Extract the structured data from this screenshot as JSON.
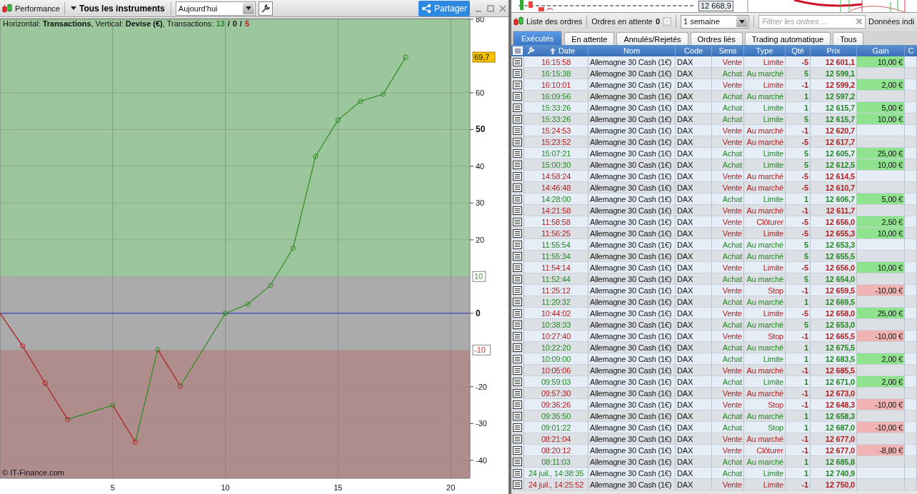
{
  "performance": {
    "title": "Performance",
    "instrument_menu": "Tous les instruments",
    "period": "Aujourd'hui",
    "share_button": "Partager",
    "info": {
      "text": "Horizontal: **Transactions**, Vertical: **Devise (€)**, Transactions:",
      "separator": "/",
      "counts": [
        {
          "value": "13",
          "kind": "win"
        },
        {
          "value": "0",
          "kind": "neutral"
        },
        {
          "value": "5",
          "kind": "loss"
        }
      ]
    },
    "chart": {
      "chart_data": {
        "type": "line",
        "x": [
          0,
          1,
          2,
          3,
          5,
          6,
          7,
          8,
          10,
          11,
          12,
          13,
          14,
          15,
          16,
          17,
          18
        ],
        "series": [
          {
            "color": "#b01c1c",
            "marker": "o",
            "values": [
              0,
              -8.9,
              -19,
              -28.9,
              null,
              null,
              null,
              null,
              null,
              null,
              null,
              null,
              null,
              null,
              null,
              null,
              null
            ]
          },
          {
            "color": "#2e8b22",
            "marker": "o",
            "values": [
              null,
              null,
              null,
              -28.9,
              -25,
              null,
              null,
              null,
              null,
              null,
              null,
              null,
              null,
              null,
              null,
              null,
              null
            ]
          },
          {
            "color": "#b01c1c",
            "marker": "o",
            "values": [
              null,
              null,
              null,
              null,
              -25,
              -35,
              null,
              null,
              null,
              null,
              null,
              null,
              null,
              null,
              null,
              null,
              null
            ]
          },
          {
            "color": "#2e8b22",
            "marker": "o",
            "values": [
              null,
              null,
              null,
              null,
              null,
              -35,
              -9.9,
              null,
              null,
              null,
              null,
              null,
              null,
              null,
              null,
              null,
              null
            ]
          },
          {
            "color": "#b01c1c",
            "marker": "o",
            "values": [
              null,
              null,
              null,
              null,
              null,
              null,
              -9.9,
              -19.8,
              null,
              null,
              null,
              null,
              null,
              null,
              null,
              null,
              null
            ]
          },
          {
            "color": "#2e8b22",
            "marker": "o",
            "values": [
              null,
              null,
              null,
              null,
              null,
              null,
              null,
              -19.8,
              0,
              2.5,
              7.6,
              17.7,
              42.7,
              52.6,
              57.7,
              59.6,
              69.7
            ]
          }
        ],
        "xlim": [
          0,
          20.85
        ],
        "ylim": [
          -44.9,
          80.2
        ],
        "xticks": [
          5,
          10,
          15,
          20
        ],
        "grid": true,
        "yticks": [
          {
            "value": 80,
            "label": "80"
          },
          {
            "value": 69.7,
            "label": "69,7"
          },
          {
            "value": 60,
            "label": "60"
          },
          {
            "value": 50,
            "label": "50"
          },
          {
            "value": 40,
            "label": "40"
          },
          {
            "value": 30,
            "label": "30"
          },
          {
            "value": 20,
            "label": "20"
          },
          {
            "value": 10,
            "label": "10"
          },
          {
            "value": 0,
            "label": "0"
          },
          {
            "value": -10,
            "label": "-10"
          },
          {
            "value": -20,
            "label": "-20"
          },
          {
            "value": -30,
            "label": "-30"
          },
          {
            "value": -40,
            "label": "-40"
          }
        ],
        "bands": [
          {
            "axis": "y",
            "from": 10,
            "to": 80.2,
            "color": "#9cc69c"
          },
          {
            "axis": "y",
            "from": -10,
            "to": 10,
            "color": "#ababab"
          },
          {
            "axis": "y",
            "from": -44.9,
            "to": -10,
            "color": "#b08d8d"
          }
        ],
        "ref_lines": [
          {
            "axis": "y",
            "value": 0,
            "color": "#2233cc"
          }
        ]
      }
    },
    "copyright": "© IT-Finance.com"
  },
  "orders": {
    "preview_price": "12 668,9",
    "title": "Liste des ordres",
    "pending_label": "Ordres en attente",
    "pending_count": "0",
    "period": "1 semaine",
    "filter": {
      "placeholder": "Filtrer les ordres ..."
    },
    "data_label": "Données indi",
    "tabs": [
      {
        "label": "Exécutés",
        "selected": true
      },
      {
        "label": "En attente",
        "selected": false
      },
      {
        "label": "Annulés/Rejetés",
        "selected": false
      },
      {
        "label": "Ordres liés",
        "selected": false
      },
      {
        "label": "Trading automatique",
        "selected": false
      },
      {
        "label": "Tous",
        "selected": false
      }
    ],
    "table": {
      "columns": [
        {
          "label": "Date",
          "sorted": true
        },
        {
          "label": "Nom",
          "sorted": false
        },
        {
          "label": "Code",
          "sorted": false
        },
        {
          "label": "Sens",
          "sorted": false
        },
        {
          "label": "Type",
          "sorted": false
        },
        {
          "label": "Qté",
          "sorted": false
        },
        {
          "label": "Prix",
          "sorted": false
        },
        {
          "label": "Gain",
          "sorted": false
        },
        {
          "label": "C",
          "sorted": false
        }
      ],
      "rows": [
        {
          "date": "16:15:58",
          "name": "Allemagne 30 Cash (1€)",
          "code": "DAX",
          "side": "Vente",
          "kind": "sell",
          "type": "Limite",
          "qty": "-5",
          "price": "12 601,1",
          "gain": {
            "text": "10,00 €",
            "color": "#8fe38f"
          }
        },
        {
          "date": "16:15:38",
          "name": "Allemagne 30 Cash (1€)",
          "code": "DAX",
          "side": "Achat",
          "kind": "buy",
          "type": "Au marché",
          "qty": "5",
          "price": "12 599,1"
        },
        {
          "date": "16:10:01",
          "name": "Allemagne 30 Cash (1€)",
          "code": "DAX",
          "side": "Vente",
          "kind": "sell",
          "type": "Limite",
          "qty": "-1",
          "price": "12 599,2",
          "gain": {
            "text": "2,00 €",
            "color": "#8fe38f"
          }
        },
        {
          "date": "16:09:56",
          "name": "Allemagne 30 Cash (1€)",
          "code": "DAX",
          "side": "Achat",
          "kind": "buy",
          "type": "Au marché",
          "qty": "1",
          "price": "12 597,2"
        },
        {
          "date": "15:33:26",
          "name": "Allemagne 30 Cash (1€)",
          "code": "DAX",
          "side": "Achat",
          "kind": "buy",
          "type": "Limite",
          "qty": "1",
          "price": "12 615,7",
          "gain": {
            "text": "5,00 €",
            "color": "#8fe38f"
          }
        },
        {
          "date": "15:33:26",
          "name": "Allemagne 30 Cash (1€)",
          "code": "DAX",
          "side": "Achat",
          "kind": "buy",
          "type": "Limite",
          "qty": "5",
          "price": "12 615,7",
          "gain": {
            "text": "10,00 €",
            "color": "#8fe38f"
          }
        },
        {
          "date": "15:24:53",
          "name": "Allemagne 30 Cash (1€)",
          "code": "DAX",
          "side": "Vente",
          "kind": "sell",
          "type": "Au marché",
          "qty": "-1",
          "price": "12 620,7"
        },
        {
          "date": "15:23:52",
          "name": "Allemagne 30 Cash (1€)",
          "code": "DAX",
          "side": "Vente",
          "kind": "sell",
          "type": "Au marché",
          "qty": "-5",
          "price": "12 617,7"
        },
        {
          "date": "15:07:21",
          "name": "Allemagne 30 Cash (1€)",
          "code": "DAX",
          "side": "Achat",
          "kind": "buy",
          "type": "Limite",
          "qty": "5",
          "price": "12 605,7",
          "gain": {
            "text": "25,00 €",
            "color": "#8fe38f"
          }
        },
        {
          "date": "15:00:30",
          "name": "Allemagne 30 Cash (1€)",
          "code": "DAX",
          "side": "Achat",
          "kind": "buy",
          "type": "Limite",
          "qty": "5",
          "price": "12 612,5",
          "gain": {
            "text": "10,00 €",
            "color": "#8fe38f"
          }
        },
        {
          "date": "14:58:24",
          "name": "Allemagne 30 Cash (1€)",
          "code": "DAX",
          "side": "Vente",
          "kind": "sell",
          "type": "Au marché",
          "qty": "-5",
          "price": "12 614,5"
        },
        {
          "date": "14:46:48",
          "name": "Allemagne 30 Cash (1€)",
          "code": "DAX",
          "side": "Vente",
          "kind": "sell",
          "type": "Au marché",
          "qty": "-5",
          "price": "12 610,7"
        },
        {
          "date": "14:28:00",
          "name": "Allemagne 30 Cash (1€)",
          "code": "DAX",
          "side": "Achat",
          "kind": "buy",
          "type": "Limite",
          "qty": "1",
          "price": "12 606,7",
          "gain": {
            "text": "5,00 €",
            "color": "#8fe38f"
          }
        },
        {
          "date": "14:21:58",
          "name": "Allemagne 30 Cash (1€)",
          "code": "DAX",
          "side": "Vente",
          "kind": "sell",
          "type": "Au marché",
          "qty": "-1",
          "price": "12 611,7"
        },
        {
          "date": "11:58:58",
          "name": "Allemagne 30 Cash (1€)",
          "code": "DAX",
          "side": "Vente",
          "kind": "sell",
          "type": "Clôturer",
          "qty": "-5",
          "price": "12 656,0",
          "gain": {
            "text": "2,50 €",
            "color": "#8fe38f"
          }
        },
        {
          "date": "11:56:25",
          "name": "Allemagne 30 Cash (1€)",
          "code": "DAX",
          "side": "Vente",
          "kind": "sell",
          "type": "Limite",
          "qty": "-5",
          "price": "12 655,3",
          "gain": {
            "text": "10,00 €",
            "color": "#8fe38f"
          }
        },
        {
          "date": "11:55:54",
          "name": "Allemagne 30 Cash (1€)",
          "code": "DAX",
          "side": "Achat",
          "kind": "buy",
          "type": "Au marché",
          "qty": "5",
          "price": "12 653,3"
        },
        {
          "date": "11:55:34",
          "name": "Allemagne 30 Cash (1€)",
          "code": "DAX",
          "side": "Achat",
          "kind": "buy",
          "type": "Au marché",
          "qty": "5",
          "price": "12 655,5"
        },
        {
          "date": "11:54:14",
          "name": "Allemagne 30 Cash (1€)",
          "code": "DAX",
          "side": "Vente",
          "kind": "sell",
          "type": "Limite",
          "qty": "-5",
          "price": "12 656,0",
          "gain": {
            "text": "10,00 €",
            "color": "#8fe38f"
          }
        },
        {
          "date": "11:52:44",
          "name": "Allemagne 30 Cash (1€)",
          "code": "DAX",
          "side": "Achat",
          "kind": "buy",
          "type": "Au marché",
          "qty": "5",
          "price": "12 654,0"
        },
        {
          "date": "11:25:12",
          "name": "Allemagne 30 Cash (1€)",
          "code": "DAX",
          "side": "Vente",
          "kind": "sell",
          "type": "Stop",
          "qty": "-1",
          "price": "12 659,5",
          "gain": {
            "text": "-10,00 €",
            "color": "#f0b3b3"
          }
        },
        {
          "date": "11:20:32",
          "name": "Allemagne 30 Cash (1€)",
          "code": "DAX",
          "side": "Achat",
          "kind": "buy",
          "type": "Au marché",
          "qty": "1",
          "price": "12 669,5"
        },
        {
          "date": "10:44:02",
          "name": "Allemagne 30 Cash (1€)",
          "code": "DAX",
          "side": "Vente",
          "kind": "sell",
          "type": "Limite",
          "qty": "-5",
          "price": "12 658,0",
          "gain": {
            "text": "25,00 €",
            "color": "#8fe38f"
          }
        },
        {
          "date": "10:38:33",
          "name": "Allemagne 30 Cash (1€)",
          "code": "DAX",
          "side": "Achat",
          "kind": "buy",
          "type": "Au marché",
          "qty": "5",
          "price": "12 653,0"
        },
        {
          "date": "10:27:40",
          "name": "Allemagne 30 Cash (1€)",
          "code": "DAX",
          "side": "Vente",
          "kind": "sell",
          "type": "Stop",
          "qty": "-1",
          "price": "12 665,5",
          "gain": {
            "text": "-10,00 €",
            "color": "#f0b3b3"
          }
        },
        {
          "date": "10:22:20",
          "name": "Allemagne 30 Cash (1€)",
          "code": "DAX",
          "side": "Achat",
          "kind": "buy",
          "type": "Au marché",
          "qty": "1",
          "price": "12 675,5"
        },
        {
          "date": "10:09:00",
          "name": "Allemagne 30 Cash (1€)",
          "code": "DAX",
          "side": "Achat",
          "kind": "buy",
          "type": "Limite",
          "qty": "1",
          "price": "12 683,5",
          "gain": {
            "text": "2,00 €",
            "color": "#8fe38f"
          }
        },
        {
          "date": "10:05:06",
          "name": "Allemagne 30 Cash (1€)",
          "code": "DAX",
          "side": "Vente",
          "kind": "sell",
          "type": "Au marché",
          "qty": "-1",
          "price": "12 685,5"
        },
        {
          "date": "09:59:03",
          "name": "Allemagne 30 Cash (1€)",
          "code": "DAX",
          "side": "Achat",
          "kind": "buy",
          "type": "Limite",
          "qty": "1",
          "price": "12 671,0",
          "gain": {
            "text": "2,00 €",
            "color": "#8fe38f"
          }
        },
        {
          "date": "09:57:30",
          "name": "Allemagne 30 Cash (1€)",
          "code": "DAX",
          "side": "Vente",
          "kind": "sell",
          "type": "Au marché",
          "qty": "-1",
          "price": "12 673,0"
        },
        {
          "date": "09:36:26",
          "name": "Allemagne 30 Cash (1€)",
          "code": "DAX",
          "side": "Vente",
          "kind": "sell",
          "type": "Stop",
          "qty": "-1",
          "price": "12 648,3",
          "gain": {
            "text": "-10,00 €",
            "color": "#f0b3b3"
          }
        },
        {
          "date": "09:35:50",
          "name": "Allemagne 30 Cash (1€)",
          "code": "DAX",
          "side": "Achat",
          "kind": "buy",
          "type": "Au marché",
          "qty": "1",
          "price": "12 658,3"
        },
        {
          "date": "09:01:22",
          "name": "Allemagne 30 Cash (1€)",
          "code": "DAX",
          "side": "Achat",
          "kind": "buy",
          "type": "Stop",
          "qty": "1",
          "price": "12 687,0",
          "gain": {
            "text": "-10,00 €",
            "color": "#f0b3b3"
          }
        },
        {
          "date": "08:21:04",
          "name": "Allemagne 30 Cash (1€)",
          "code": "DAX",
          "side": "Vente",
          "kind": "sell",
          "type": "Au marché",
          "qty": "-1",
          "price": "12 677,0"
        },
        {
          "date": "08:20:12",
          "name": "Allemagne 30 Cash (1€)",
          "code": "DAX",
          "side": "Vente",
          "kind": "sell",
          "type": "Clôturer",
          "qty": "-1",
          "price": "12 677,0",
          "gain": {
            "text": "-8,80 €",
            "color": "#f0b3b3"
          }
        },
        {
          "date": "08:11:03",
          "name": "Allemagne 30 Cash (1€)",
          "code": "DAX",
          "side": "Achat",
          "kind": "buy",
          "type": "Au marché",
          "qty": "1",
          "price": "12 685,8"
        },
        {
          "date": "24 juil., 14:38:35",
          "name": "Allemagne 30 Cash (1€)",
          "code": "DAX",
          "side": "Achat",
          "kind": "buy",
          "type": "Limite",
          "qty": "1",
          "price": "12 740,9"
        },
        {
          "date": "24 juil., 14:25:52",
          "name": "Allemagne 30 Cash (1€)",
          "code": "DAX",
          "side": "Vente",
          "kind": "sell",
          "type": "Limite",
          "qty": "-1",
          "price": "12 750,0"
        }
      ]
    }
  }
}
